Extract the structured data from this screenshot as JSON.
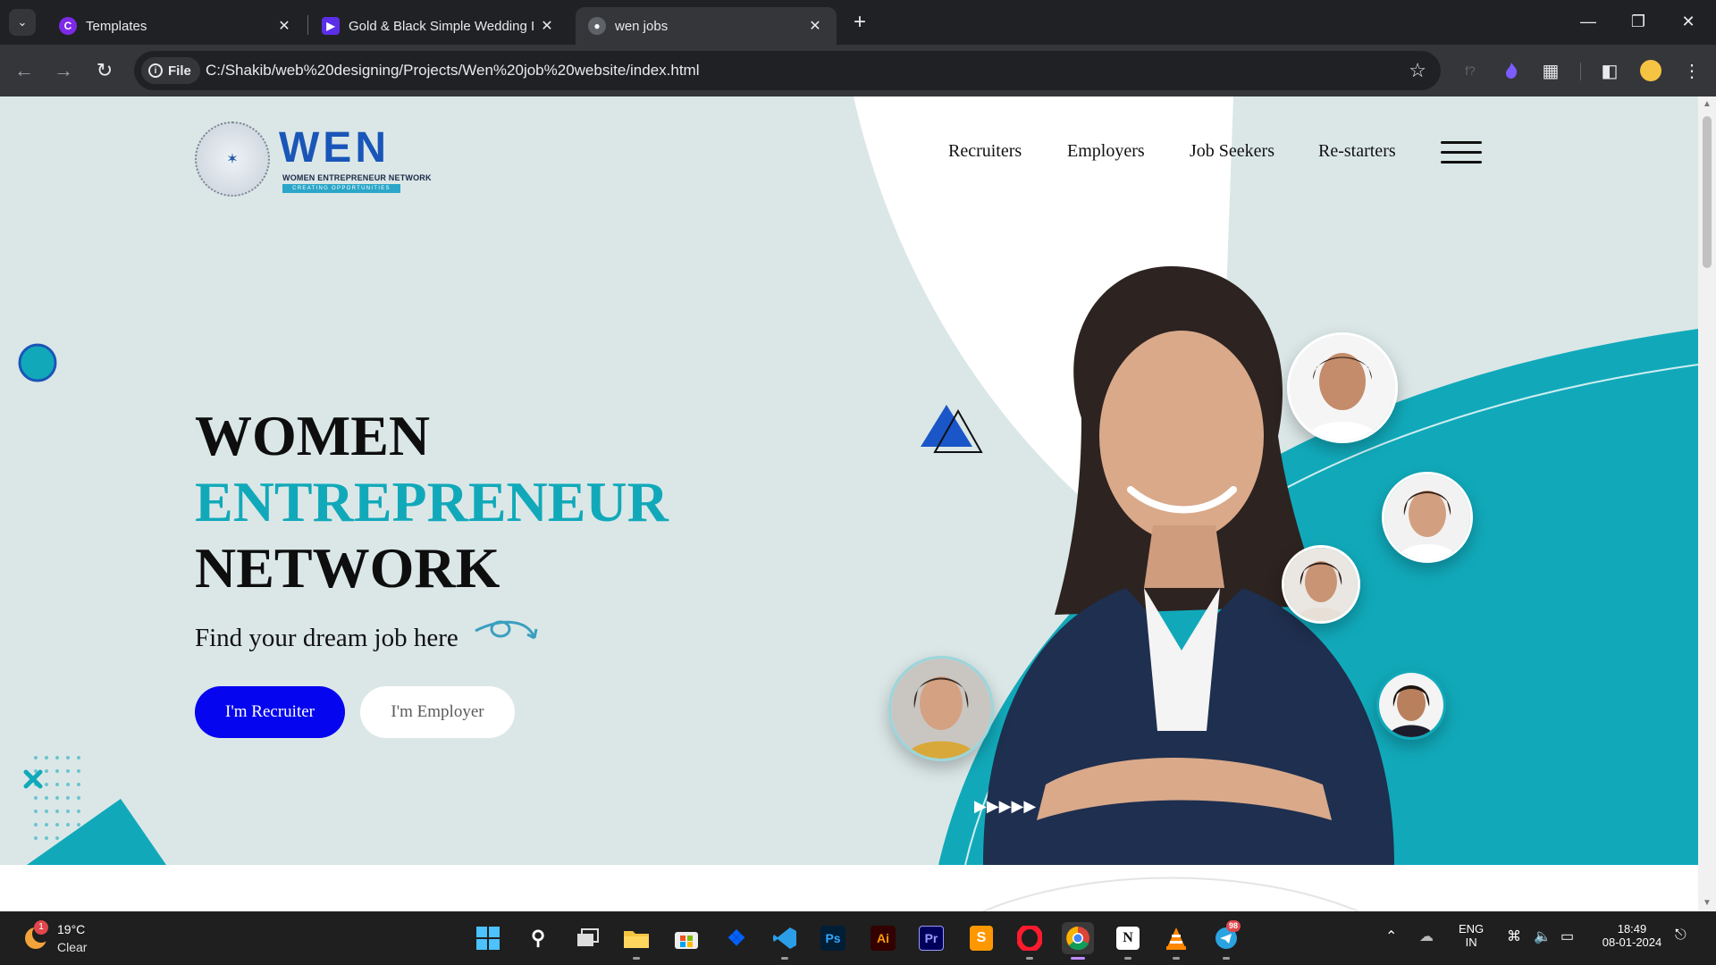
{
  "browser": {
    "tabs": [
      {
        "title": "Templates",
        "active": false
      },
      {
        "title": "Gold & Black Simple Wedding I",
        "active": false
      },
      {
        "title": "wen jobs",
        "active": true
      }
    ],
    "address_chip": "File",
    "url": "C:/Shakib/web%20designing/Projects/Wen%20job%20website/index.html"
  },
  "page": {
    "logo": {
      "word": "WEN",
      "subtitle": "WOMEN ENTREPRENEUR NETWORK",
      "tagline": "CREATING OPPORTUNITIES"
    },
    "nav": {
      "links": [
        "Recruiters",
        "Employers",
        "Job Seekers",
        "Re-starters"
      ]
    },
    "hero": {
      "line1": "WOMEN",
      "line2": "ENTREPRENEUR",
      "line3": "NETWORK",
      "subtitle": "Find your dream job here",
      "primary_button": "I'm Recruiter",
      "secondary_button": "I'm Employer"
    },
    "colors": {
      "accent_teal": "#11a9ba",
      "hero_background": "#dbe7e7",
      "primary_button": "#0505f0"
    }
  },
  "taskbar": {
    "weather": {
      "temp": "19°C",
      "desc": "Clear",
      "badge": "1"
    },
    "apps": [
      "windows-start",
      "search",
      "task-view",
      "file-explorer",
      "microsoft-store",
      "dropbox",
      "vscode",
      "photoshop",
      "illustrator",
      "premiere-pro",
      "sublime-text",
      "opera",
      "chrome",
      "notion",
      "vlc",
      "telegram"
    ],
    "telegram_badge": "98",
    "language": {
      "line1": "ENG",
      "line2": "IN"
    },
    "clock": {
      "time": "18:49",
      "date": "08-01-2024"
    }
  }
}
